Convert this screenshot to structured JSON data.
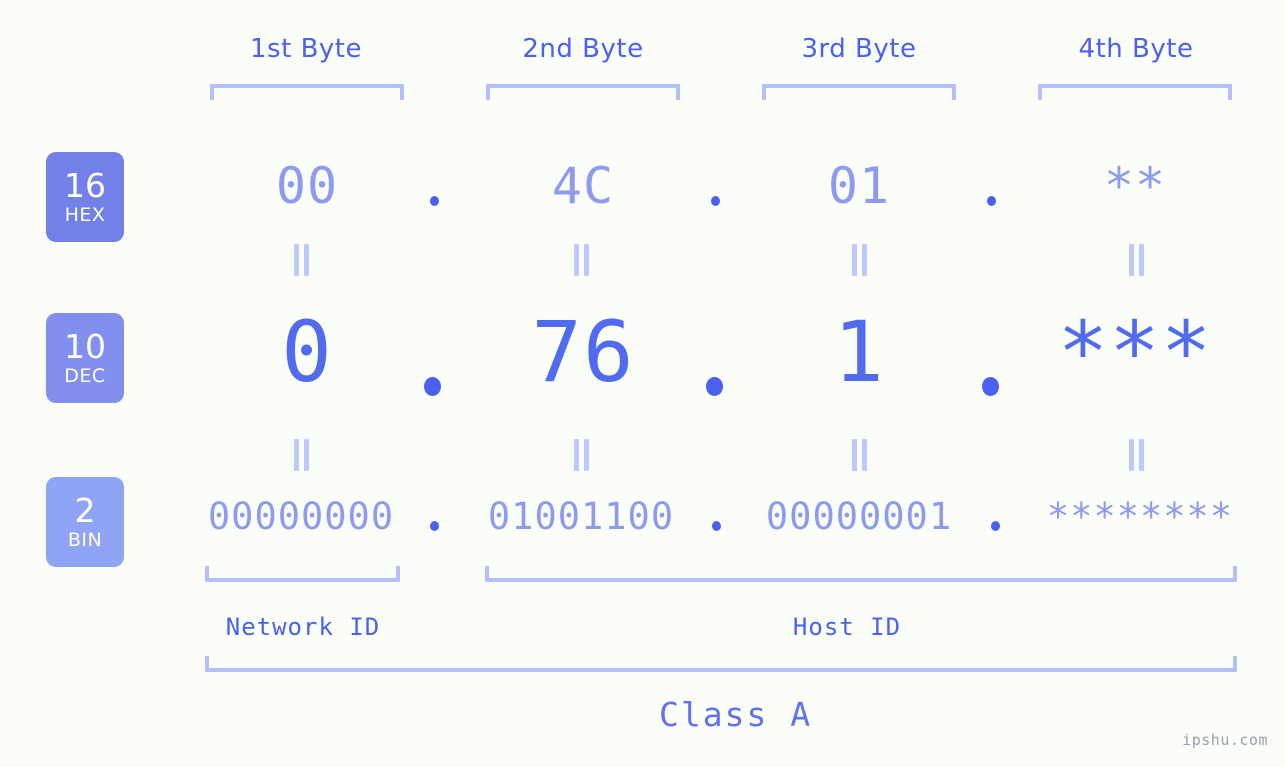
{
  "watermark": "ipshu.com",
  "byte_headers": [
    {
      "label": "1st Byte"
    },
    {
      "label": "2nd Byte"
    },
    {
      "label": "3rd Byte"
    },
    {
      "label": "4th Byte"
    }
  ],
  "bases": [
    {
      "number": "16",
      "name": "HEX",
      "color": "#7280e8"
    },
    {
      "number": "10",
      "name": "DEC",
      "color": "#838fee"
    },
    {
      "number": "2",
      "name": "BIN",
      "color": "#8fa4f5"
    }
  ],
  "rows": {
    "hex": {
      "values": [
        "00",
        "4C",
        "01",
        "**"
      ]
    },
    "dec": {
      "values": [
        "0",
        "76",
        "1",
        "***"
      ]
    },
    "bin": {
      "values": [
        "00000000",
        "01001100",
        "00000001",
        "********"
      ]
    }
  },
  "separator": ".",
  "equals_mark": "||",
  "sections": [
    {
      "label": "Network ID"
    },
    {
      "label": "Host ID"
    }
  ],
  "class_label": "Class A",
  "colors": {
    "background": "#fbfdf9",
    "accent_strong": "#4a61ef",
    "accent_mid": "#8c9bf0",
    "accent_light": "#b3befc",
    "dec_value": "#506af0"
  }
}
